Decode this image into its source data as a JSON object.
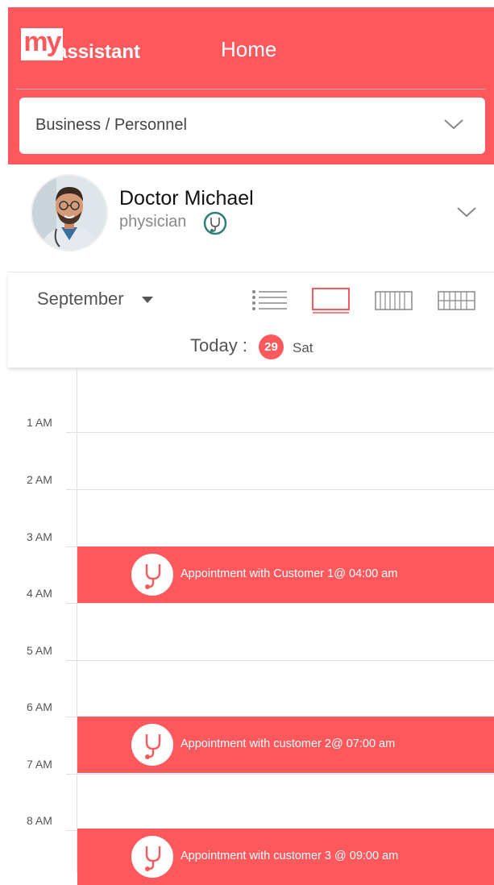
{
  "header": {
    "logo_my": "my",
    "logo_assistant": "assistant",
    "title": "Home",
    "dropdown_value": "Business / Personnel"
  },
  "profile": {
    "name": "Doctor Michael",
    "role": "physician"
  },
  "toolbar": {
    "month": "September",
    "views": [
      "list-view-icon",
      "day-view-icon",
      "week-view-icon",
      "month-view-icon"
    ],
    "active_view": "day-view-icon",
    "today_label": "Today :",
    "today_date": "29",
    "today_day": "Sat"
  },
  "timeline": {
    "hours": [
      "1 AM",
      "2 AM",
      "3 AM",
      "4 AM",
      "5 AM",
      "6 AM",
      "7 AM",
      "8 AM"
    ],
    "appointments": [
      {
        "text": "Appointment with Customer 1@ 04:00 am",
        "icon": "stethoscope-icon"
      },
      {
        "text": "Appointment with customer 2@ 07:00 am",
        "icon": "stethoscope-icon"
      },
      {
        "text": "Appointment with customer 3 @ 09:00 am",
        "icon": "stethoscope-icon"
      }
    ]
  },
  "colors": {
    "accent": "#fd595d",
    "text": "#555555",
    "divider": "#e0e0e0"
  }
}
